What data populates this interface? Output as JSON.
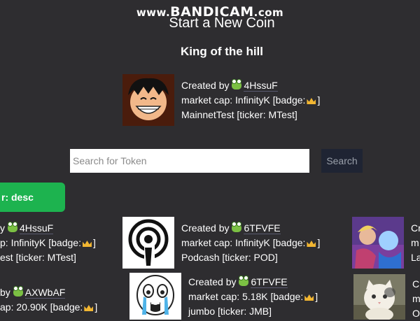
{
  "watermark": {
    "prefix": "www.",
    "brand": "BANDICAM",
    "suffix": ".com"
  },
  "header": {
    "title": "Start a New Coin"
  },
  "king_of_the_hill": {
    "title": "King of the hill",
    "created_by_label": "Created by",
    "creator": "4HssuF",
    "market_cap_text": "market cap: InfinityK [badge:",
    "name_ticker": "MainnetTest [ticker: MTest]",
    "image_icon": "luffy-avatar"
  },
  "search": {
    "placeholder": "Search for Token",
    "button_label": "Search"
  },
  "sort": {
    "label": "r: desc"
  },
  "tokens": [
    {
      "creator_text": "y",
      "creator": "4HssuF",
      "market_cap_text": "p: InfinityK [badge:",
      "name_ticker": "est [ticker: MTest]"
    },
    {
      "created_by_label": "Created by",
      "creator": "6TFVFE",
      "market_cap_text": "market cap: InfinityK [badge:",
      "name_ticker": "Podcash [ticker: POD]",
      "image_icon": "podcast-icon"
    },
    {
      "created_by_label": "Cr",
      "market_cap_text": "m",
      "name_ticker": "La",
      "image_icon": "anime-card"
    },
    {
      "creator_text": "by",
      "creator": "AXWbAF",
      "market_cap_text": "ap: 20.90K [badge:",
      "name_ticker": ""
    },
    {
      "created_by_label": "Created by",
      "creator": "6TFVFE",
      "market_cap_text": "market cap: 5.18K [badge:",
      "name_ticker": "jumbo [ticker: JMB]",
      "image_icon": "crying-meme"
    },
    {
      "created_by_label": "C",
      "market_cap_text": "m",
      "name_ticker": "O",
      "image_icon": "kitten-photo"
    }
  ]
}
